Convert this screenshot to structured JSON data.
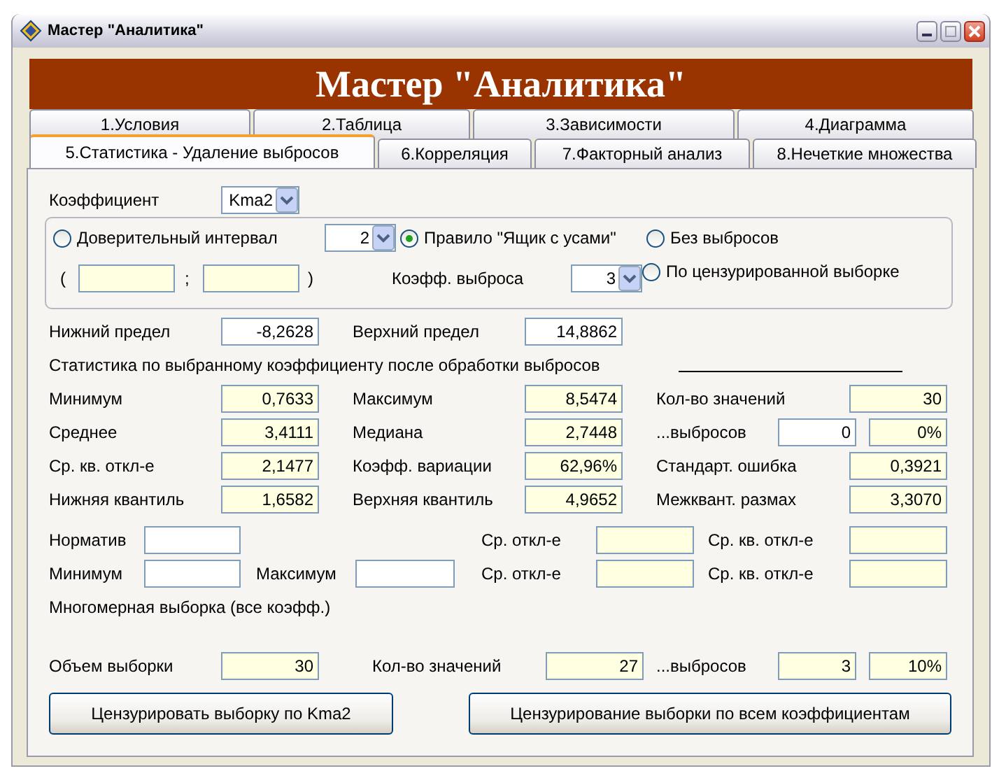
{
  "window": {
    "title": "Мастер \"Аналитика\""
  },
  "header": "Мастер \"Аналитика\"",
  "tab_rows": [
    [
      {
        "label": "1.Условия",
        "selected": false
      },
      {
        "label": "2.Таблица",
        "selected": false
      },
      {
        "label": "3.Зависимости",
        "selected": false
      },
      {
        "label": "4.Диаграмма",
        "selected": false
      }
    ],
    [
      {
        "label": "5.Статистика - Удаление выбросов",
        "selected": true
      },
      {
        "label": "6.Корреляция",
        "selected": false
      },
      {
        "label": "7.Факторный анализ",
        "selected": false
      },
      {
        "label": "8.Нечеткие множества",
        "selected": false
      }
    ]
  ],
  "coefficient": {
    "label": "Коэффициент",
    "value": "Kma2"
  },
  "method": {
    "radios": [
      {
        "label": "Доверительный интервал",
        "selected": false
      },
      {
        "label": "Правило \"Ящик с усами\"",
        "selected": true
      },
      {
        "label": "Без выбросов",
        "selected": false
      },
      {
        "label": "По цензурированной выборке",
        "selected": false
      }
    ],
    "confidence_value": "2",
    "open_paren": "(",
    "separator": ";",
    "close_paren": ")",
    "outlier_coef_label": "Коэфф. выброса",
    "outlier_coef_value": "3"
  },
  "limits": {
    "lower_label": "Нижний предел",
    "lower_value": "-8,2628",
    "upper_label": "Верхний предел",
    "upper_value": "14,8862"
  },
  "stats_title": "Статистика по выбранному коэффициенту после обработки выбросов",
  "stats_rows": [
    {
      "cells": [
        {
          "kind": "label",
          "text": "Минимум"
        },
        {
          "kind": "output",
          "text": "0,7633"
        },
        {
          "kind": "label",
          "text": "Максимум"
        },
        {
          "kind": "output",
          "text": "8,5474"
        },
        {
          "kind": "label",
          "text": "Кол-во значений"
        },
        {
          "kind": "output",
          "text": "30"
        }
      ]
    },
    {
      "cells": [
        {
          "kind": "label",
          "text": "Среднее"
        },
        {
          "kind": "output",
          "text": "3,4111"
        },
        {
          "kind": "label",
          "text": "Медиана"
        },
        {
          "kind": "output",
          "text": "2,7448"
        },
        {
          "kind": "label",
          "text": "...выбросов"
        },
        {
          "kind": "input",
          "text": "0"
        },
        {
          "kind": "output",
          "text": "0%"
        }
      ]
    },
    {
      "cells": [
        {
          "kind": "label",
          "text": "Ср. кв. откл-е"
        },
        {
          "kind": "output",
          "text": "2,1477"
        },
        {
          "kind": "label",
          "text": "Коэфф. вариации"
        },
        {
          "kind": "output",
          "text": "62,96%"
        },
        {
          "kind": "label",
          "text": "Стандарт. ошибка"
        },
        {
          "kind": "output",
          "text": "0,3921"
        }
      ]
    },
    {
      "cells": [
        {
          "kind": "label",
          "text": "Нижняя квантиль"
        },
        {
          "kind": "output",
          "text": "1,6582"
        },
        {
          "kind": "label",
          "text": "Верхняя квантиль"
        },
        {
          "kind": "output",
          "text": "4,9652"
        },
        {
          "kind": "label",
          "text": "Межквант. размах"
        },
        {
          "kind": "output",
          "text": "3,3070"
        }
      ]
    }
  ],
  "norm_rows": [
    {
      "cells": [
        {
          "kind": "label",
          "text": "Норматив"
        },
        {
          "kind": "input"
        },
        {
          "kind": "label",
          "text": "Ср. откл-е"
        },
        {
          "kind": "output"
        },
        {
          "kind": "label",
          "text": "Ср. кв. откл-е"
        },
        {
          "kind": "output"
        }
      ]
    },
    {
      "cells": [
        {
          "kind": "label",
          "text": "Минимум"
        },
        {
          "kind": "input"
        },
        {
          "kind": "label",
          "text": "Максимум"
        },
        {
          "kind": "input"
        },
        {
          "kind": "label",
          "text": "Ср. откл-е"
        },
        {
          "kind": "output"
        },
        {
          "kind": "label",
          "text": "Ср. кв. откл-е"
        },
        {
          "kind": "output"
        }
      ]
    }
  ],
  "multi_title": "Многомерная выборка (все коэфф.)",
  "totals": {
    "cells": [
      {
        "kind": "label",
        "text": "Объем выборки"
      },
      {
        "kind": "output",
        "text": "30"
      },
      {
        "kind": "label",
        "text": "Кол-во значений"
      },
      {
        "kind": "output",
        "text": "27"
      },
      {
        "kind": "label",
        "text": "...выбросов"
      },
      {
        "kind": "output",
        "text": "3"
      },
      {
        "kind": "output",
        "text": "10%"
      }
    ]
  },
  "buttons": [
    "Цензурировать выборку по Kma2",
    "Цензурирование выборки по всем коэффициентам"
  ]
}
